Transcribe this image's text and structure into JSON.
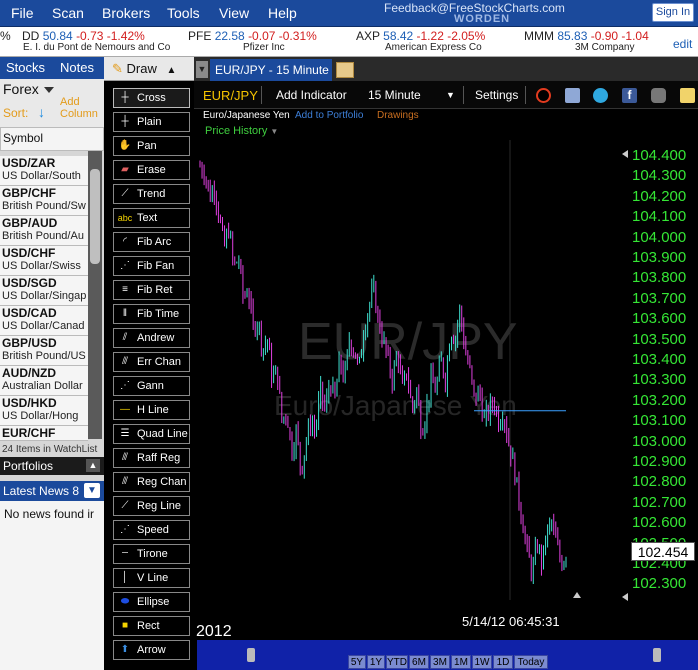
{
  "menubar": {
    "items": [
      "File",
      "Scan",
      "Brokers",
      "Tools",
      "View",
      "Help"
    ],
    "feedback": "Feedback@FreeStockCharts.com",
    "brand": "WORDEN",
    "sign_in": "Sign In"
  },
  "ticker": {
    "items": [
      {
        "symbol": "DD",
        "price": "50.84",
        "change": "-0.73",
        "pct": "-1.42%",
        "name": "E. I. du Pont de Nemours and Co"
      },
      {
        "symbol": "PFE",
        "price": "22.58",
        "change": "-0.07",
        "pct": "-0.31%",
        "name": "Pfizer Inc"
      },
      {
        "symbol": "AXP",
        "price": "58.42",
        "change": "-1.22",
        "pct": "-2.05%",
        "name": "American Express Co"
      },
      {
        "symbol": "MMM",
        "price": "85.83",
        "change": "-0.90",
        "pct": "-1.04",
        "name": "3M Company"
      }
    ],
    "lead_fragment": "%",
    "edit": "edit"
  },
  "left_panel": {
    "tabs": [
      "Stocks",
      "Notes"
    ],
    "list_name": "Forex",
    "sort_label": "Sort:",
    "add_column": "Add Column",
    "symbol_header": "Symbol",
    "watchlist": [
      {
        "symbol": "USD/ZAR",
        "name": "US Dollar/South"
      },
      {
        "symbol": "GBP/CHF",
        "name": "British Pound/Sw"
      },
      {
        "symbol": "GBP/AUD",
        "name": "British Pound/Au"
      },
      {
        "symbol": "USD/CHF",
        "name": "US Dollar/Swiss"
      },
      {
        "symbol": "USD/SGD",
        "name": "US Dollar/Singap"
      },
      {
        "symbol": "USD/CAD",
        "name": "US Dollar/Canad"
      },
      {
        "symbol": "GBP/USD",
        "name": "British Pound/US"
      },
      {
        "symbol": "AUD/NZD",
        "name": "Australian Dollar"
      },
      {
        "symbol": "USD/HKD",
        "name": "US Dollar/Hong"
      },
      {
        "symbol": "EUR/CHF",
        "name": ""
      }
    ],
    "item_count": "24 Items in WatchList",
    "portfolios": "Portfolios",
    "latest_news": "Latest News 8",
    "no_news": "No news found ir"
  },
  "draw_toolbar": {
    "title": "Draw",
    "tools": [
      {
        "label": "Cross",
        "icon": "cross-icon"
      },
      {
        "label": "Plain",
        "icon": "plain-cursor-icon"
      },
      {
        "label": "Pan",
        "icon": "hand-icon"
      },
      {
        "label": "Erase",
        "icon": "eraser-icon"
      },
      {
        "label": "Trend",
        "icon": "trendline-icon"
      },
      {
        "label": "Text",
        "icon": "text-icon"
      },
      {
        "label": "Fib Arc",
        "icon": "fib-arc-icon"
      },
      {
        "label": "Fib Fan",
        "icon": "fib-fan-icon"
      },
      {
        "label": "Fib Ret",
        "icon": "fib-retracement-icon"
      },
      {
        "label": "Fib Time",
        "icon": "fib-time-icon"
      },
      {
        "label": "Andrew",
        "icon": "andrews-pitchfork-icon"
      },
      {
        "label": "Err Chan",
        "icon": "error-channel-icon"
      },
      {
        "label": "Gann",
        "icon": "gann-fan-icon"
      },
      {
        "label": "H Line",
        "icon": "horizontal-line-icon"
      },
      {
        "label": "Quad Line",
        "icon": "quad-line-icon"
      },
      {
        "label": "Raff Reg",
        "icon": "raff-regression-icon"
      },
      {
        "label": "Reg Chan",
        "icon": "regression-channel-icon"
      },
      {
        "label": "Reg Line",
        "icon": "regression-line-icon"
      },
      {
        "label": "Speed",
        "icon": "speed-lines-icon"
      },
      {
        "label": "Tirone",
        "icon": "tirone-levels-icon"
      },
      {
        "label": "V Line",
        "icon": "vertical-line-icon"
      },
      {
        "label": "Ellipse",
        "icon": "ellipse-icon"
      },
      {
        "label": "Rect",
        "icon": "rectangle-icon"
      },
      {
        "label": "Arrow",
        "icon": "arrow-icon"
      }
    ]
  },
  "chart": {
    "tab_label": "EUR/JPY - 15 Minute",
    "symbol": "EUR/JPY",
    "add_indicator": "Add Indicator",
    "interval": "15 Minute",
    "settings": "Settings",
    "symbol_name": "Euro/Japanese Yen",
    "add_to_portfolio": "Add to Portfolio",
    "drawings": "Drawings",
    "price_history": "Price History",
    "watermark_symbol": "EUR/JPY",
    "watermark_name": "Euro/Japanese Yen",
    "current_price": "102.454",
    "timestamp": "5/14/12 06:45:31",
    "year": "2012",
    "y_labels": [
      "104.400",
      "104.300",
      "104.200",
      "104.100",
      "104.000",
      "103.900",
      "103.800",
      "103.700",
      "103.600",
      "103.500",
      "103.400",
      "103.300",
      "103.200",
      "103.100",
      "103.000",
      "102.900",
      "102.800",
      "102.700",
      "102.600",
      "102.500",
      "102.400",
      "102.300"
    ],
    "nav_buttons": [
      "5Y",
      "1Y",
      "YTD",
      "6M",
      "3M",
      "1M",
      "1W",
      "1D",
      "Today"
    ],
    "colors": {
      "up_bar": "#40e0d0",
      "down_bar": "#e040e0",
      "axis_text": "#35e635",
      "line": "#3aa0ff"
    }
  },
  "chart_data": {
    "type": "candlestick",
    "title": "EUR/JPY",
    "ylim": [
      102.25,
      104.45
    ],
    "trend_closes": [
      104.35,
      104.32,
      104.2,
      104.25,
      104.1,
      103.95,
      104.05,
      103.85,
      103.9,
      103.7,
      103.75,
      103.55,
      103.6,
      103.45,
      103.5,
      103.3,
      103.35,
      103.1,
      103.15,
      102.95,
      103.05,
      102.85,
      103.0,
      103.1,
      103.05,
      103.25,
      103.15,
      103.3,
      103.2,
      103.4,
      103.3,
      103.5,
      103.45,
      103.35,
      103.55,
      103.65,
      103.75,
      103.6,
      103.5,
      103.4,
      103.3,
      103.45,
      103.25,
      103.35,
      103.15,
      103.25,
      103.05,
      103.15,
      103.3,
      103.25,
      103.4,
      103.3,
      103.55,
      103.5,
      103.65,
      103.45,
      103.35,
      103.2,
      103.25,
      103.1,
      103.15,
      103.2,
      103.1,
      103.15,
      103.0,
      102.9,
      102.75,
      102.6,
      102.45,
      102.35,
      102.5,
      102.4,
      102.55,
      102.6,
      102.5,
      102.4,
      102.45
    ],
    "hline_value": 103.15
  }
}
